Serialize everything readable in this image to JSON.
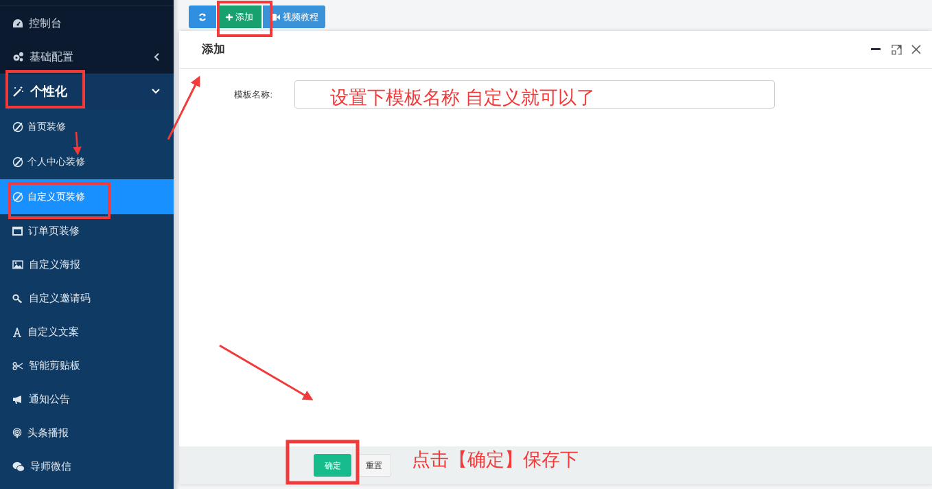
{
  "sidebar": {
    "items": [
      {
        "label": "控制台"
      },
      {
        "label": "基础配置",
        "expanded": false
      },
      {
        "label": "个性化",
        "expanded": true,
        "children": [
          {
            "label": "首页装修",
            "selected": false
          },
          {
            "label": "个人中心装修",
            "selected": false
          },
          {
            "label": "自定义页装修",
            "selected": true
          },
          {
            "label": "订单页装修",
            "selected": false
          },
          {
            "label": "自定义海报",
            "selected": false
          },
          {
            "label": "自定义邀请码",
            "selected": false
          },
          {
            "label": "自定义文案",
            "selected": false
          },
          {
            "label": "智能剪贴板",
            "selected": false
          },
          {
            "label": "通知公告",
            "selected": false
          },
          {
            "label": "头条播报",
            "selected": false
          },
          {
            "label": "导师微信",
            "selected": false
          }
        ]
      }
    ]
  },
  "toolbar": {
    "buttons": [
      {
        "kind": "refresh"
      },
      {
        "kind": "add",
        "label": "添加"
      },
      {
        "kind": "video",
        "label": "视频教程"
      }
    ]
  },
  "dialog": {
    "title": "添加",
    "fields": [
      {
        "label": "模板名称:"
      }
    ],
    "footer_buttons": [
      {
        "kind": "primary",
        "label": "确定"
      },
      {
        "kind": "default",
        "label": "重置"
      }
    ]
  },
  "annotations": {
    "notes": [
      "设置下模板名称 自定义就可以了",
      "点击【确定】保存下"
    ]
  }
}
